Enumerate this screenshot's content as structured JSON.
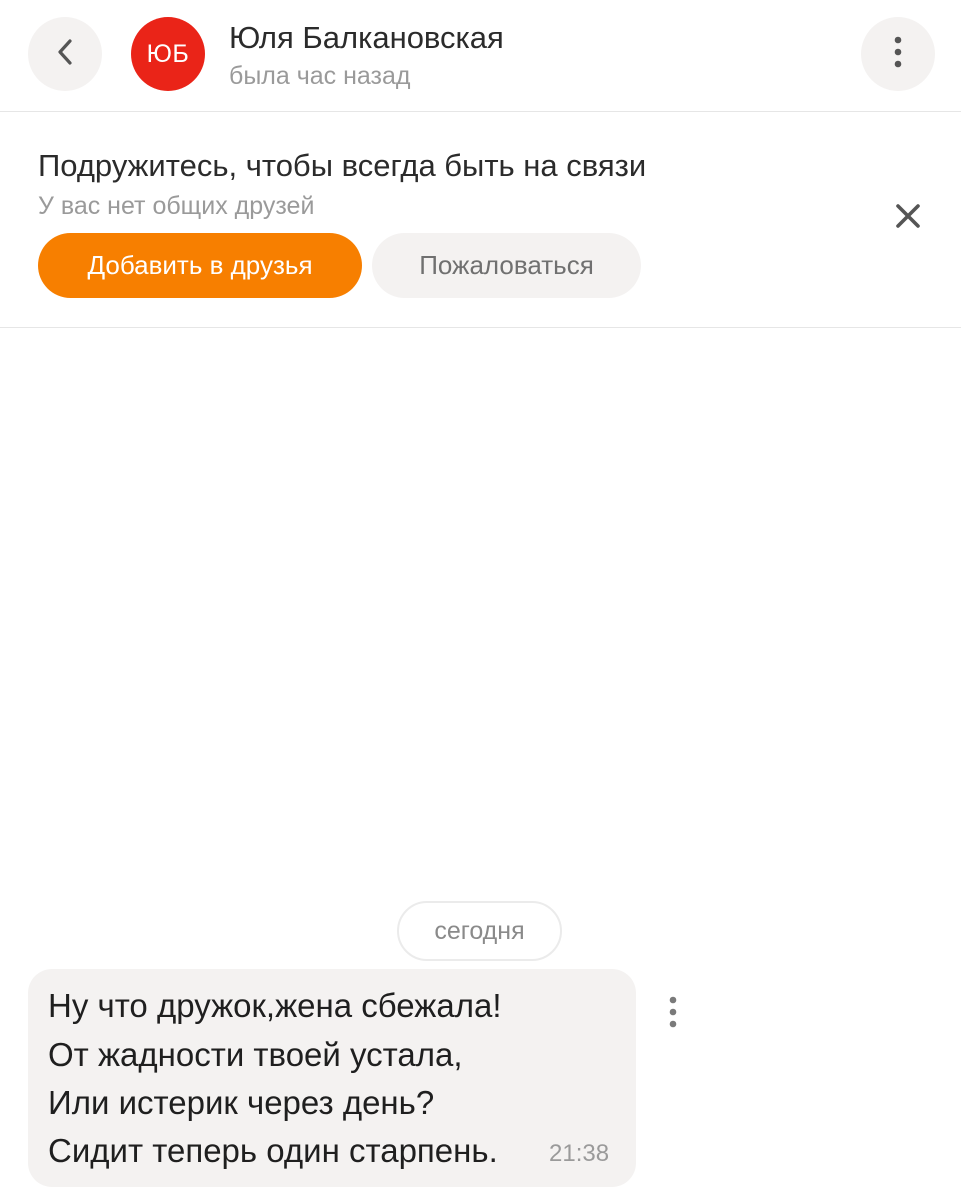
{
  "header": {
    "avatar_initials": "ЮБ",
    "avatar_color": "#ea2418",
    "name": "Юля Балкановская",
    "status": "была час назад",
    "back_icon": "chevron-left-icon",
    "menu_icon": "more-vertical-icon"
  },
  "suggestion": {
    "title": "Подружитесь, чтобы всегда быть на связи",
    "subtitle": "У вас нет общих друзей",
    "add_friend_label": "Добавить в друзья",
    "report_label": "Пожаловаться",
    "close_icon": "close-icon",
    "accent_color": "#f77f00"
  },
  "chat": {
    "date_label": "сегодня",
    "messages": [
      {
        "lines": [
          "Ну что дружок,жена сбежала!",
          "От жадности твоей устала,",
          "Или истерик через день?",
          "Сидит теперь один старпень."
        ],
        "time": "21:38",
        "menu_icon": "more-vertical-icon"
      }
    ]
  }
}
